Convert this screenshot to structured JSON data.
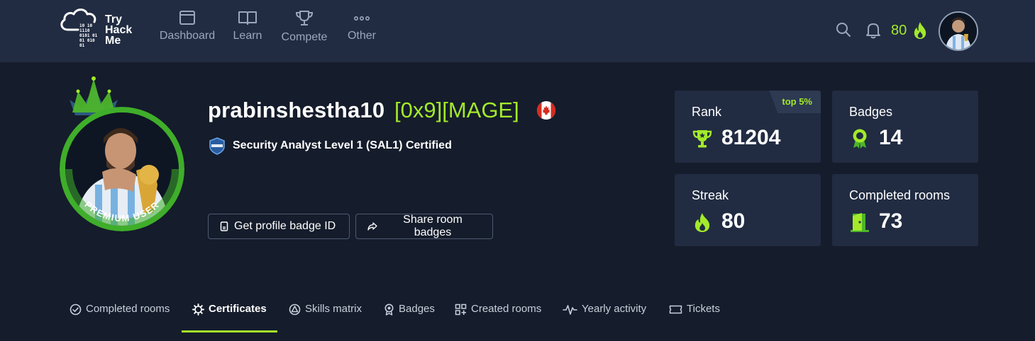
{
  "brand": {
    "line1": "Try",
    "line2": "Hack",
    "line3": "Me",
    "bits": [
      "10 10",
      "1110",
      "0101 01",
      "01 010",
      "01"
    ]
  },
  "nav": [
    {
      "label": "Dashboard",
      "icon": "dashboard-icon"
    },
    {
      "label": "Learn",
      "icon": "book-icon"
    },
    {
      "label": "Compete",
      "icon": "trophy-icon"
    },
    {
      "label": "Other",
      "icon": "dots-icon"
    }
  ],
  "topbar": {
    "streak": "80",
    "streak_icon": "flame-icon"
  },
  "profile": {
    "username": "prabinshestha10",
    "rank_title": "[0x9][MAGE]",
    "country": "Canada",
    "avatar_ring_text": "PREMIUM USER",
    "certification": "Security Analyst Level 1 (SAL1) Certified",
    "buttons": {
      "badge_id": "Get profile badge ID",
      "share": "Share room badges"
    }
  },
  "stats": {
    "rank": {
      "title": "Rank",
      "value": "81204",
      "badge": "top 5%"
    },
    "badges": {
      "title": "Badges",
      "value": "14"
    },
    "streak": {
      "title": "Streak",
      "value": "80"
    },
    "completed": {
      "title": "Completed rooms",
      "value": "73"
    }
  },
  "tabs": [
    {
      "label": "Completed rooms",
      "icon": "check-circle-icon",
      "active": false
    },
    {
      "label": "Certificates",
      "icon": "gear-icon",
      "active": true
    },
    {
      "label": "Skills matrix",
      "icon": "radar-icon",
      "active": false
    },
    {
      "label": "Badges",
      "icon": "medal-icon",
      "active": false
    },
    {
      "label": "Created rooms",
      "icon": "grid-plus-icon",
      "active": false
    },
    {
      "label": "Yearly activity",
      "icon": "activity-icon",
      "active": false
    },
    {
      "label": "Tickets",
      "icon": "ticket-icon",
      "active": false
    }
  ],
  "colors": {
    "accent": "#a3ea2a",
    "nav_bg": "#212c42",
    "page_bg": "#151c2b",
    "card_bg": "#212c42"
  }
}
